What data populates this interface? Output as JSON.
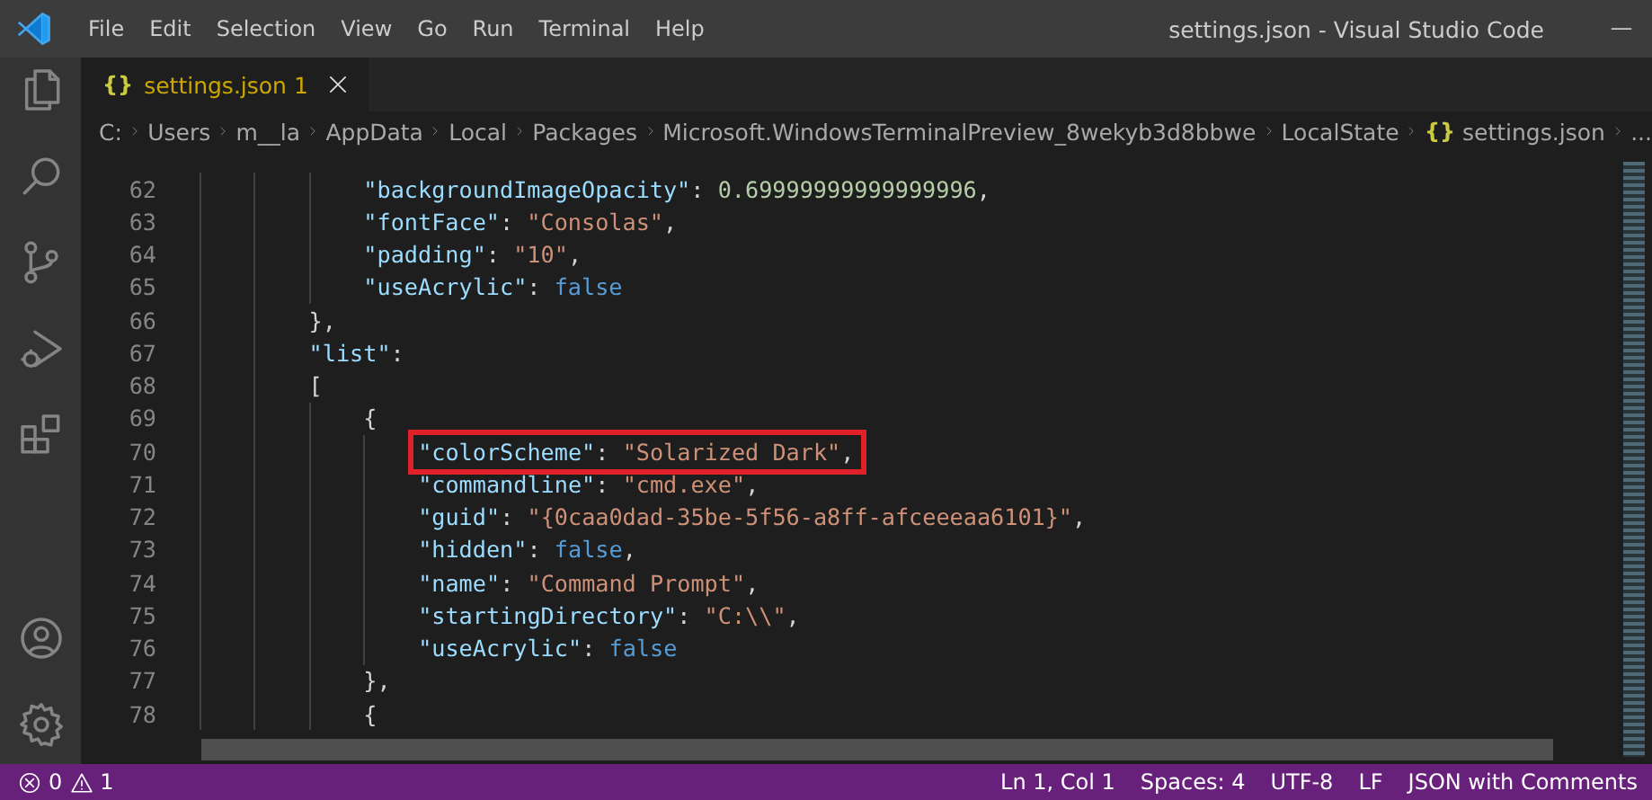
{
  "window": {
    "title": "settings.json - Visual Studio Code"
  },
  "menu": [
    "File",
    "Edit",
    "Selection",
    "View",
    "Go",
    "Run",
    "Terminal",
    "Help"
  ],
  "activity_bar": {
    "top": [
      {
        "kind": "files",
        "selected": false
      },
      {
        "kind": "search",
        "selected": false
      },
      {
        "kind": "source-control",
        "selected": false
      },
      {
        "kind": "run",
        "selected": false
      },
      {
        "kind": "extensions",
        "selected": false
      }
    ],
    "bottom": [
      {
        "kind": "account"
      },
      {
        "kind": "settings"
      }
    ]
  },
  "tabs": [
    {
      "icon": "{}",
      "label": "settings.json 1",
      "selected": true
    }
  ],
  "breadcrumb": [
    {
      "label": "C:"
    },
    {
      "label": "Users"
    },
    {
      "label": "m__la"
    },
    {
      "label": "AppData"
    },
    {
      "label": "Local"
    },
    {
      "label": "Packages"
    },
    {
      "label": "Microsoft.WindowsTerminalPreview_8wekyb3d8bbwe"
    },
    {
      "label": "LocalState"
    },
    {
      "icon": "{}",
      "label": "settings.json"
    },
    {
      "label": "..."
    }
  ],
  "editor": {
    "lines": [
      {
        "children": [
          {
            "number": "62",
            "highlighted": false,
            "tokens": [
              {
                "kind": "key",
                "text": "\"backgroundImageOpacity\""
              },
              {
                "kind": "punct",
                "text": ": "
              },
              {
                "kind": "number",
                "text": "0.69999999999999996"
              },
              {
                "kind": "punct",
                "text": ","
              }
            ]
          },
          {
            "number": "63",
            "highlighted": false,
            "tokens": [
              {
                "kind": "key",
                "text": "\"fontFace\""
              },
              {
                "kind": "punct",
                "text": ": "
              },
              {
                "kind": "string",
                "text": "\"Consolas\""
              },
              {
                "kind": "punct",
                "text": ","
              }
            ]
          },
          {
            "number": "64",
            "highlighted": false,
            "tokens": [
              {
                "kind": "key",
                "text": "\"padding\""
              },
              {
                "kind": "punct",
                "text": ": "
              },
              {
                "kind": "string",
                "text": "\"10\""
              },
              {
                "kind": "punct",
                "text": ","
              }
            ]
          },
          {
            "number": "65",
            "highlighted": false,
            "tokens": [
              {
                "kind": "key",
                "text": "\"useAcrylic\""
              },
              {
                "kind": "punct",
                "text": ": "
              },
              {
                "kind": "keyword",
                "text": "false"
              }
            ]
          }
        ]
      },
      {
        "number": "66",
        "highlighted": false,
        "tokens": [
          {
            "kind": "punct",
            "text": "},"
          }
        ]
      },
      {
        "number": "67",
        "highlighted": false,
        "tokens": [
          {
            "kind": "key",
            "text": "\"list\""
          },
          {
            "kind": "punct",
            "text": ":"
          }
        ]
      },
      {
        "number": "68",
        "highlighted": false,
        "tokens": [
          {
            "kind": "punct",
            "text": "["
          }
        ],
        "children": [
          {
            "number": "69",
            "highlighted": false,
            "tokens": [
              {
                "kind": "punct",
                "text": "{"
              }
            ],
            "children": [
              {
                "number": "70",
                "highlighted": true,
                "tokens": [
                  {
                    "kind": "key",
                    "text": "\"colorScheme\""
                  },
                  {
                    "kind": "punct",
                    "text": ": "
                  },
                  {
                    "kind": "string",
                    "text": "\"Solarized Dark\""
                  },
                  {
                    "kind": "punct",
                    "text": ","
                  }
                ]
              },
              {
                "number": "71",
                "highlighted": false,
                "tokens": [
                  {
                    "kind": "key",
                    "text": "\"commandline\""
                  },
                  {
                    "kind": "punct",
                    "text": ": "
                  },
                  {
                    "kind": "string",
                    "text": "\"cmd.exe\""
                  },
                  {
                    "kind": "punct",
                    "text": ","
                  }
                ]
              },
              {
                "number": "72",
                "highlighted": false,
                "tokens": [
                  {
                    "kind": "key",
                    "text": "\"guid\""
                  },
                  {
                    "kind": "punct",
                    "text": ": "
                  },
                  {
                    "kind": "string",
                    "text": "\"{0caa0dad-35be-5f56-a8ff-afceeeaa6101}\""
                  },
                  {
                    "kind": "punct",
                    "text": ","
                  }
                ]
              },
              {
                "number": "73",
                "highlighted": false,
                "tokens": [
                  {
                    "kind": "key",
                    "text": "\"hidden\""
                  },
                  {
                    "kind": "punct",
                    "text": ": "
                  },
                  {
                    "kind": "keyword",
                    "text": "false"
                  },
                  {
                    "kind": "punct",
                    "text": ","
                  }
                ]
              },
              {
                "number": "74",
                "highlighted": false,
                "tokens": [
                  {
                    "kind": "key",
                    "text": "\"name\""
                  },
                  {
                    "kind": "punct",
                    "text": ": "
                  },
                  {
                    "kind": "string",
                    "text": "\"Command Prompt\""
                  },
                  {
                    "kind": "punct",
                    "text": ","
                  }
                ]
              },
              {
                "number": "75",
                "highlighted": false,
                "tokens": [
                  {
                    "kind": "key",
                    "text": "\"startingDirectory\""
                  },
                  {
                    "kind": "punct",
                    "text": ": "
                  },
                  {
                    "kind": "string",
                    "text": "\"C:\\\\\""
                  },
                  {
                    "kind": "punct",
                    "text": ","
                  }
                ]
              },
              {
                "number": "76",
                "highlighted": false,
                "tokens": [
                  {
                    "kind": "key",
                    "text": "\"useAcrylic\""
                  },
                  {
                    "kind": "punct",
                    "text": ": "
                  },
                  {
                    "kind": "keyword",
                    "text": "false"
                  }
                ]
              }
            ]
          },
          {
            "number": "77",
            "highlighted": false,
            "tokens": [
              {
                "kind": "punct",
                "text": "},"
              }
            ]
          },
          {
            "number": "78",
            "highlighted": false,
            "tokens": [
              {
                "kind": "punct",
                "text": "{"
              }
            ]
          }
        ]
      }
    ]
  },
  "status_bar": {
    "errors": "0",
    "warnings": "1",
    "right": [
      "Ln 1, Col 1",
      "Spaces: 4",
      "UTF-8",
      "LF",
      "JSON with Comments"
    ]
  }
}
